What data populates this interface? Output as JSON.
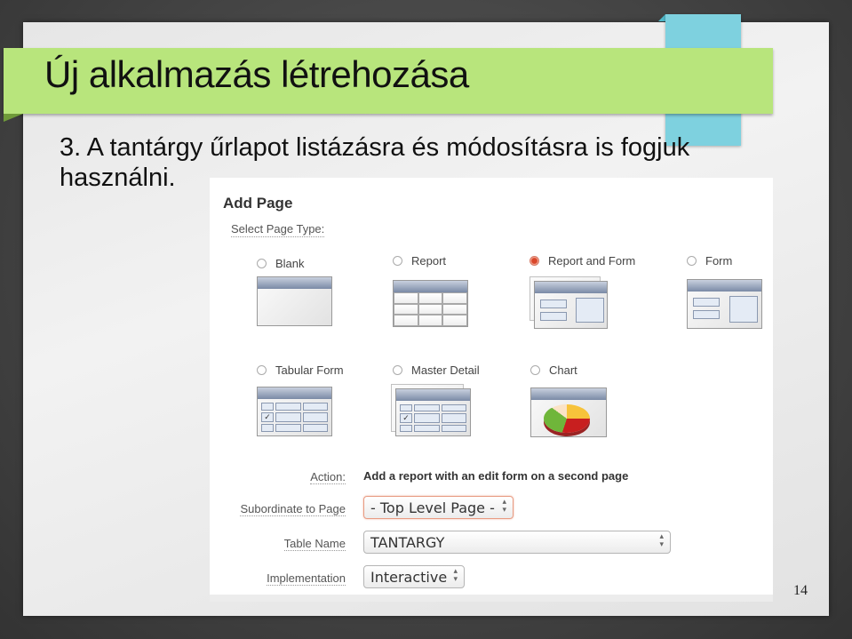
{
  "slide": {
    "title": "Új alkalmazás létrehozása",
    "body": "3. A tantárgy űrlapot listázásra és módosításra is fogjuk használni.",
    "page_number": "14",
    "colors": {
      "title_band": "#b8e57c",
      "ribbon": "#7ed1df"
    }
  },
  "screenshot": {
    "heading": "Add Page",
    "select_label": "Select Page Type:",
    "page_types": [
      {
        "label": "Blank",
        "selected": false
      },
      {
        "label": "Report",
        "selected": false
      },
      {
        "label": "Report and Form",
        "selected": true
      },
      {
        "label": "Form",
        "selected": false
      },
      {
        "label": "Tabular Form",
        "selected": false
      },
      {
        "label": "Master Detail",
        "selected": false
      },
      {
        "label": "Chart",
        "selected": false
      }
    ],
    "form": {
      "action_label": "Action:",
      "action_value": "Add a report with an edit form on a second page",
      "subordinate_label": "Subordinate to Page",
      "subordinate_value": "- Top Level Page -",
      "table_label": "Table Name",
      "table_value": "TANTARGY",
      "implementation_label": "Implementation",
      "implementation_value": "Interactive"
    },
    "icons": {
      "select_arrows": "⬍"
    }
  }
}
